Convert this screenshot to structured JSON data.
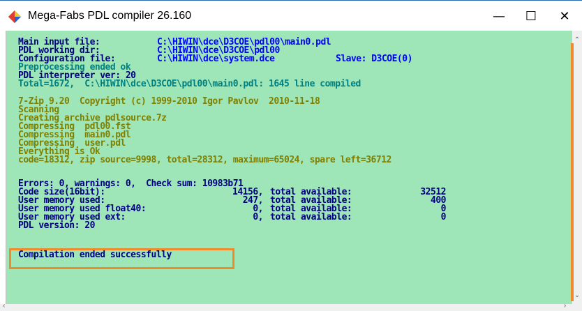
{
  "window": {
    "title": "Mega-Fabs PDL compiler 26.160",
    "icon": "mega-fabs-app-icon",
    "controls": {
      "minimize": "—",
      "maximize": "☐",
      "close": "✕"
    }
  },
  "colors": {
    "console_bg": "#9ee6b8",
    "navy": "#000080",
    "blue": "#0000ff",
    "teal": "#008080",
    "olive": "#808000",
    "highlight": "#f08a2a"
  },
  "console": {
    "header": {
      "main_input_label": "Main input file:",
      "main_input_value": "C:\\HIWIN\\dce\\D3COE\\pdl00\\main0.pdl",
      "working_dir_label": "PDL working dir:",
      "working_dir_value": "C:\\HIWIN\\dce\\D3COE\\pdl00",
      "config_label": "Configuration file:",
      "config_value": "C:\\HIWIN\\dce\\system.dce",
      "slave_value": "Slave: D3COE(0)",
      "preprocessing": "Preprocessing ended ok",
      "interpreter": "PDL interpreter ver: 20",
      "total": "Total=1672,  C:\\HIWIN\\dce\\D3COE\\pdl00\\main0.pdl: 1645 line compiled"
    },
    "zip": {
      "l1": "7-Zip 9.20  Copyright (c) 1999-2010 Igor Pavlov  2010-11-18",
      "l2": "Scanning",
      "l3": "Creating archive pdlsource.7z",
      "l4": "Compressing  pdl00.fst",
      "l5": "Compressing  main0.pdl",
      "l6": "Compressing  user.pdl",
      "l7": "Everything is Ok",
      "l8": "code=18312, zip source=9998, total=28312, maximum=65024, spare left=36712"
    },
    "summary": {
      "errors": "Errors: 0, warnings: 0,  Check sum: 10983b71",
      "rows": [
        {
          "label": "Code size(16bit):",
          "value": "14156,",
          "avail_label": "total available:",
          "avail": "32512"
        },
        {
          "label": "User memory used:",
          "value": "247,",
          "avail_label": "total available:",
          "avail": "400"
        },
        {
          "label": "User memory used float40:",
          "value": "0,",
          "avail_label": "total available:",
          "avail": "0"
        },
        {
          "label": "User memory used ext:",
          "value": "0,",
          "avail_label": "total available:",
          "avail": "0"
        }
      ],
      "pdl_version": "PDL version: 20"
    },
    "final_message": "Compilation ended successfully"
  },
  "scrollbars": {
    "up": "⌃",
    "down": "⌄",
    "left": "‹",
    "right": "›"
  }
}
